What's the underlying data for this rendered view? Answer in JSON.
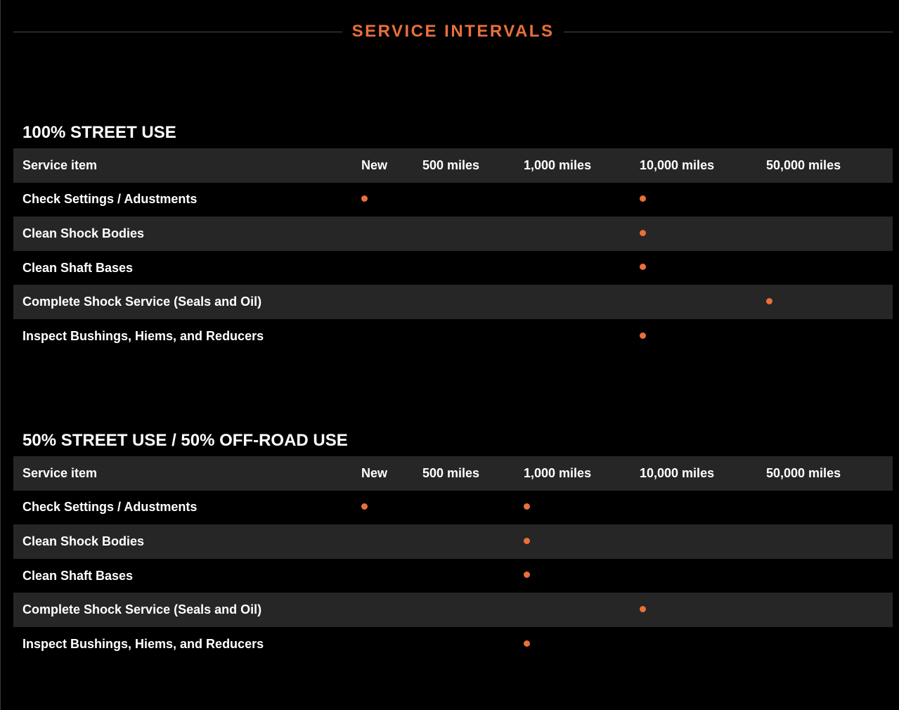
{
  "page": {
    "title": "SERVICE INTERVALS",
    "accent_color": "#e8703a",
    "row_alt_color": "#262626"
  },
  "columns": [
    "Service item",
    "New",
    "500 miles",
    "1,000 miles",
    "10,000 miles",
    "50,000 miles"
  ],
  "sections": [
    {
      "title": "100% STREET USE",
      "rows": [
        {
          "item": "Check Settings / Adustments",
          "marks": [
            true,
            false,
            false,
            true,
            false
          ]
        },
        {
          "item": "Clean Shock Bodies",
          "marks": [
            false,
            false,
            false,
            true,
            false
          ]
        },
        {
          "item": "Clean Shaft Bases",
          "marks": [
            false,
            false,
            false,
            true,
            false
          ]
        },
        {
          "item": "Complete Shock Service (Seals and Oil)",
          "marks": [
            false,
            false,
            false,
            false,
            true
          ]
        },
        {
          "item": "Inspect Bushings, Hiems, and Reducers",
          "marks": [
            false,
            false,
            false,
            true,
            false
          ]
        }
      ]
    },
    {
      "title": "50% STREET USE / 50% OFF-ROAD USE",
      "rows": [
        {
          "item": "Check Settings / Adustments",
          "marks": [
            true,
            false,
            true,
            false,
            false
          ]
        },
        {
          "item": "Clean Shock Bodies",
          "marks": [
            false,
            false,
            true,
            false,
            false
          ]
        },
        {
          "item": "Clean Shaft Bases",
          "marks": [
            false,
            false,
            true,
            false,
            false
          ]
        },
        {
          "item": "Complete Shock Service (Seals and Oil)",
          "marks": [
            false,
            false,
            false,
            true,
            false
          ]
        },
        {
          "item": "Inspect Bushings, Hiems, and Reducers",
          "marks": [
            false,
            false,
            true,
            false,
            false
          ]
        }
      ]
    }
  ]
}
